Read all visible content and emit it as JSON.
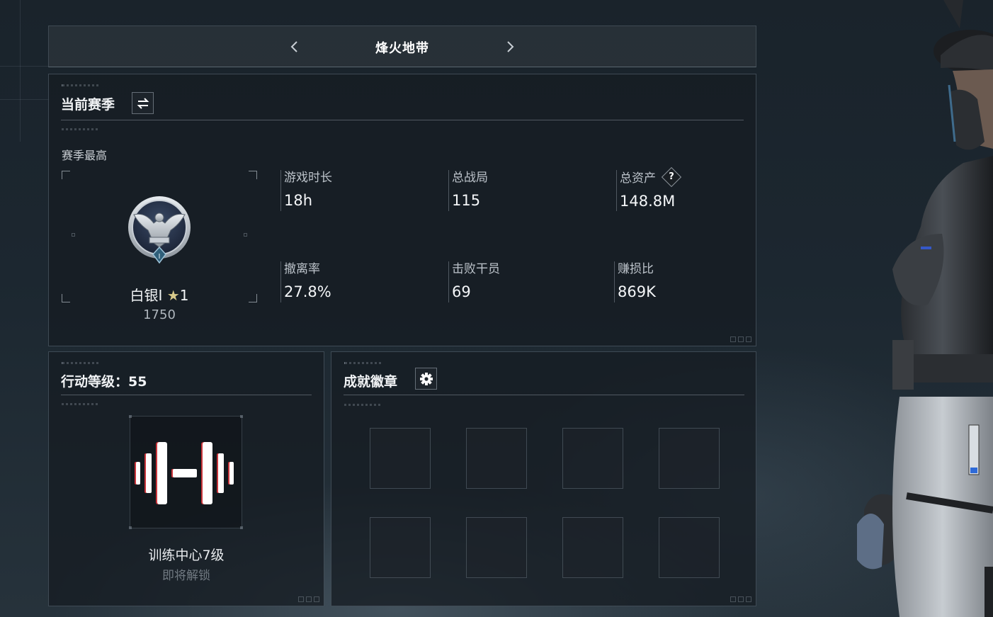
{
  "header": {
    "title": "烽火地带",
    "prev_icon": "chevron-left-icon",
    "next_icon": "chevron-right-icon"
  },
  "season": {
    "title": "当前赛季",
    "switch_icon": "swap-icon",
    "best_label": "赛季最高",
    "rank": {
      "name": "白银I",
      "stars": "1",
      "score": "1750",
      "emblem_icon": "eagle-emblem-icon"
    },
    "stats": [
      {
        "label": "游戏时长",
        "value": "18h"
      },
      {
        "label": "总战局",
        "value": "115"
      },
      {
        "label": "总资产",
        "value": "148.8M",
        "help": "?"
      },
      {
        "label": "撤离率",
        "value": "27.8%"
      },
      {
        "label": "击败干员",
        "value": "69"
      },
      {
        "label": "赚损比",
        "value": "869K"
      }
    ]
  },
  "level": {
    "title": "行动等级：55",
    "icon": "dumbbell-icon",
    "unlock_text": "训练中心7级",
    "unlock_status": "即将解锁"
  },
  "badges": {
    "title": "成就徽章",
    "settings_icon": "gear-icon",
    "slot_count": 8
  },
  "colors": {
    "panel_bg": "#161c22",
    "panel_border": "#5f6e7a",
    "text_primary": "#f0f2f4",
    "text_secondary": "#bcc3ca",
    "accent_red": "#c8343a"
  }
}
